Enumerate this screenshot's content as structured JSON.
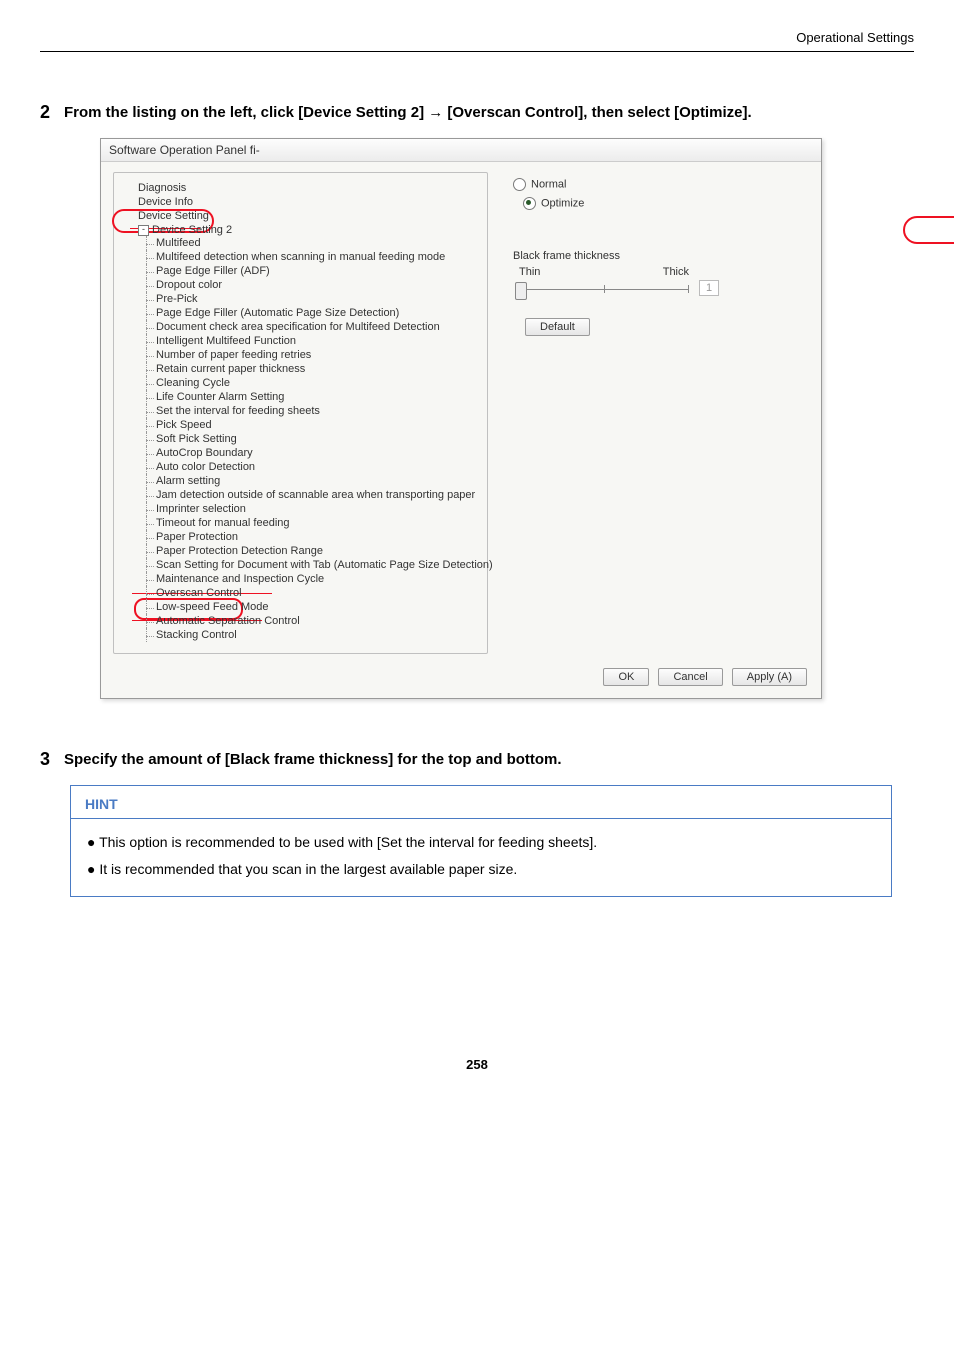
{
  "header": {
    "section": "Operational Settings"
  },
  "steps": {
    "s2": {
      "num": "2",
      "text": "From the listing on the left, click [Device Setting 2] → [Overscan Control], then select [Optimize]."
    },
    "s3": {
      "num": "3",
      "text": "Specify the amount of [Black frame thickness] for the top and bottom."
    }
  },
  "dialog": {
    "title": "Software Operation Panel fi-",
    "tree": {
      "n0": "Diagnosis",
      "n1": "Device Info",
      "n2": "Device Setting",
      "n3": "Device Setting 2",
      "items": [
        "Multifeed",
        "Multifeed detection when scanning in manual feeding mode",
        "Page Edge Filler (ADF)",
        "Dropout color",
        "Pre-Pick",
        "Page Edge Filler (Automatic Page Size Detection)",
        "Document check area specification for Multifeed Detection",
        "Intelligent Multifeed Function",
        "Number of paper feeding retries",
        "Retain current paper thickness",
        "Cleaning Cycle",
        "Life Counter Alarm Setting",
        "Set the interval for feeding sheets",
        "Pick Speed",
        "Soft Pick Setting",
        "AutoCrop Boundary",
        "Auto color Detection",
        "Alarm setting",
        "Jam detection outside of scannable area when transporting paper",
        "Imprinter selection",
        "Timeout for manual feeding",
        "Paper Protection",
        "Paper Protection Detection Range",
        "Scan Setting for Document with Tab (Automatic Page Size Detection)",
        "Maintenance and Inspection Cycle",
        "Overscan Control",
        "Low-speed Feed Mode",
        "Automatic Separation Control",
        "Stacking Control"
      ]
    },
    "options": {
      "normal": "Normal",
      "optimize": "Optimize",
      "thickness_label": "Black frame thickness",
      "thin": "Thin",
      "thick": "Thick",
      "value": "1",
      "default_btn": "Default"
    },
    "buttons": {
      "ok": "OK",
      "cancel": "Cancel",
      "apply": "Apply (A)"
    }
  },
  "hint": {
    "title": "HINT",
    "b1": "● This option is recommended to be used with [Set the interval for feeding sheets].",
    "b2": "● It is recommended that you scan in the largest available paper size."
  },
  "page_number": "258"
}
